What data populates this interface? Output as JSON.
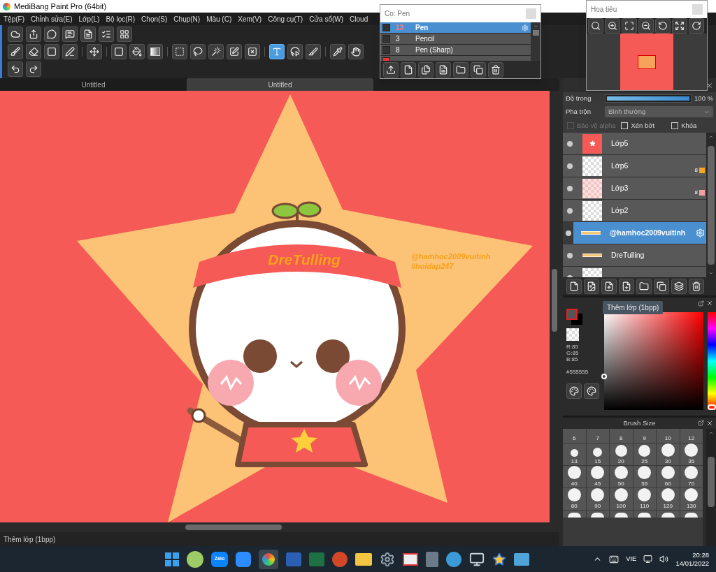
{
  "window": {
    "title": "MediBang Paint Pro (64bit)"
  },
  "menu": [
    "Tệp(F)",
    "Chỉnh sửa(E)",
    "Lớp(L)",
    "Bộ lọc(R)",
    "Chọn(S)",
    "Chụp(N)",
    "Màu (C)",
    "Xem(V)",
    "Công cụ(T)",
    "Cửa sổ(W)",
    "Cloud"
  ],
  "tools": [
    {
      "selected": false
    },
    {
      "selected": false
    },
    {
      "selected": false
    },
    {
      "selected": false
    },
    {
      "selected": false
    },
    {
      "selected": false
    },
    {
      "selected": false
    },
    {
      "selected": false
    },
    {
      "selected": false
    },
    {
      "selected": false
    },
    {
      "selected": false
    },
    {
      "selected": false
    },
    {
      "selected": false
    },
    {
      "selected": true
    },
    {
      "selected": false
    },
    {
      "selected": false
    },
    {
      "selected": false
    },
    {
      "selected": false
    }
  ],
  "document_tabs": [
    {
      "label": "Untitled",
      "selected": false
    },
    {
      "label": "Untitled",
      "selected": true
    }
  ],
  "canvas": {
    "band_text": "DreTulling",
    "credit_lines": [
      "@hamhoc2009vuitinh",
      "#hoidap247"
    ]
  },
  "status_bar": "Thêm lớp (1bpp)",
  "brush_panel": {
    "title": "Cọ: Pen",
    "brushes": [
      {
        "size": "13",
        "name": "Pen",
        "selected": true,
        "color": "#333333"
      },
      {
        "size": "3",
        "name": "Pencil",
        "selected": false,
        "color": "#333333"
      },
      {
        "size": "8",
        "name": "Pen (Sharp)",
        "selected": false,
        "color": "#333333"
      },
      {
        "selected": false,
        "color": "#ee3333"
      }
    ]
  },
  "navigator": {
    "title": "Hoa tiêu"
  },
  "layer_panel": {
    "opacity": {
      "label": "Độ trong",
      "level": 1,
      "reading": "100 %"
    },
    "blend": {
      "label": "Pha trộn",
      "value": "Bình thường"
    },
    "options": [
      {
        "label": "Bảo vệ alpha",
        "checked": false,
        "disabled": true
      },
      {
        "label": "Xén bớt",
        "checked": false,
        "disabled": false
      },
      {
        "label": "Khóa",
        "checked": false,
        "disabled": false
      }
    ],
    "layers": [
      {
        "name": "Lớp5",
        "kind": "red-star",
        "selected": false
      },
      {
        "name": "Lớp6",
        "kind": "transparent",
        "selected": false,
        "badge": "8",
        "color": "#f5a623"
      },
      {
        "name": "Lớp3",
        "kind": "pink",
        "selected": false,
        "badge": "8",
        "color": "#f4a0a0"
      },
      {
        "name": "Lớp2",
        "kind": "transparent",
        "selected": false
      },
      {
        "name": "@hamhoc2009vuitinh",
        "kind": "strip",
        "selected": true
      },
      {
        "name": "DreTulling",
        "kind": "strip",
        "selected": false
      },
      {
        "kind": "transparent",
        "selected": false
      }
    ]
  },
  "tooltip": "Thêm lớp (1bpp)",
  "color_panel": {
    "rgb": [
      "R:85",
      "G:85",
      "B:85"
    ],
    "hex": "#555555",
    "hue": {
      "level": 0
    }
  },
  "brush_size": {
    "title": "Brush Size",
    "top_labels": [
      "6",
      "7",
      "8",
      "9",
      "10",
      "12"
    ],
    "sizes": [
      "13",
      "15",
      "20",
      "25",
      "30",
      "35",
      "40",
      "45",
      "50",
      "55",
      "60",
      "70",
      "80",
      "90",
      "100",
      "110",
      "120",
      "130"
    ]
  },
  "taskbar": {
    "zalo": "Zalo",
    "language": "VIE",
    "time": "20:28",
    "date": "14/01/2022"
  }
}
